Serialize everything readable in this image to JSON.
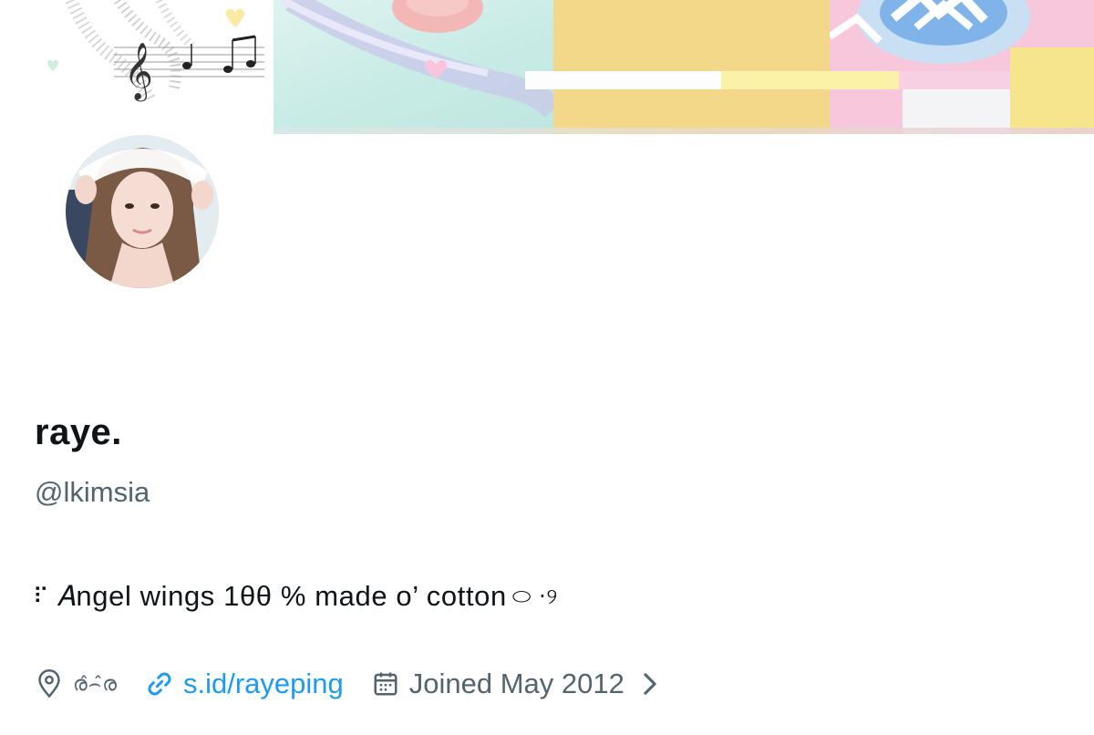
{
  "profile": {
    "display_name": "raye.",
    "handle": "@lkimsia",
    "bio": "𝐴ngel wings 1θθ % made o’ cotton",
    "bio_prefix": "⠏",
    "bio_suffix": "⬭ ·୨",
    "location": "ര̂⌢̂ര",
    "website": "s.id/rayeping",
    "joined": "Joined May 2012"
  },
  "icons": {
    "location": "map-pin-icon",
    "website": "link-icon",
    "joined": "calendar-icon",
    "more": "chevron-right-icon"
  },
  "colors": {
    "link": "#1d9bf0",
    "secondary_text": "#536471",
    "primary_text": "#0f1419"
  }
}
